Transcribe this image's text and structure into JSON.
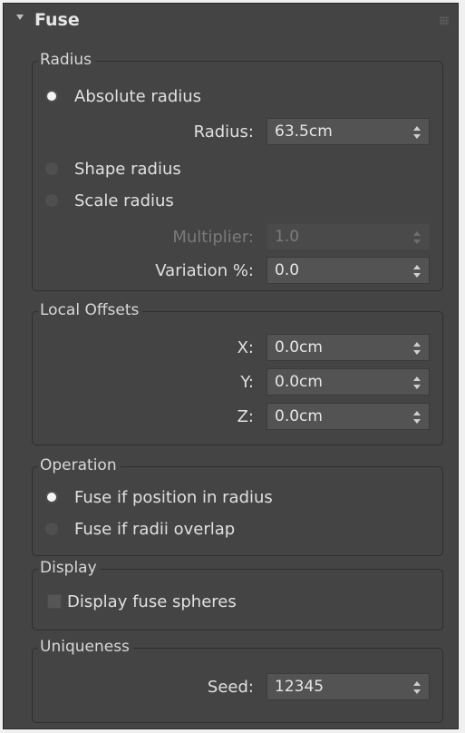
{
  "rollout": {
    "title": "Fuse"
  },
  "radius_group": {
    "title": "Radius",
    "absolute_radius": {
      "label": "Absolute radius",
      "checked": true
    },
    "radius_field": {
      "label": "Radius:",
      "value": "63.5cm"
    },
    "shape_radius": {
      "label": "Shape radius",
      "checked": false
    },
    "scale_radius": {
      "label": "Scale radius",
      "checked": false
    },
    "multiplier_field": {
      "label": "Multiplier:",
      "value": "1.0",
      "enabled": false
    },
    "variation_field": {
      "label": "Variation %:",
      "value": "0.0"
    }
  },
  "local_offsets_group": {
    "title": "Local Offsets",
    "x": {
      "label": "X:",
      "value": "0.0cm"
    },
    "y": {
      "label": "Y:",
      "value": "0.0cm"
    },
    "z": {
      "label": "Z:",
      "value": "0.0cm"
    }
  },
  "operation_group": {
    "title": "Operation",
    "fuse_position": {
      "label": "Fuse if position in radius",
      "checked": true
    },
    "fuse_overlap": {
      "label": "Fuse if radii overlap",
      "checked": false
    }
  },
  "display_group": {
    "title": "Display",
    "display_fuse_spheres": {
      "label": "Display fuse spheres",
      "checked": false
    }
  },
  "uniqueness_group": {
    "title": "Uniqueness",
    "seed": {
      "label": "Seed:",
      "value": "12345"
    }
  }
}
